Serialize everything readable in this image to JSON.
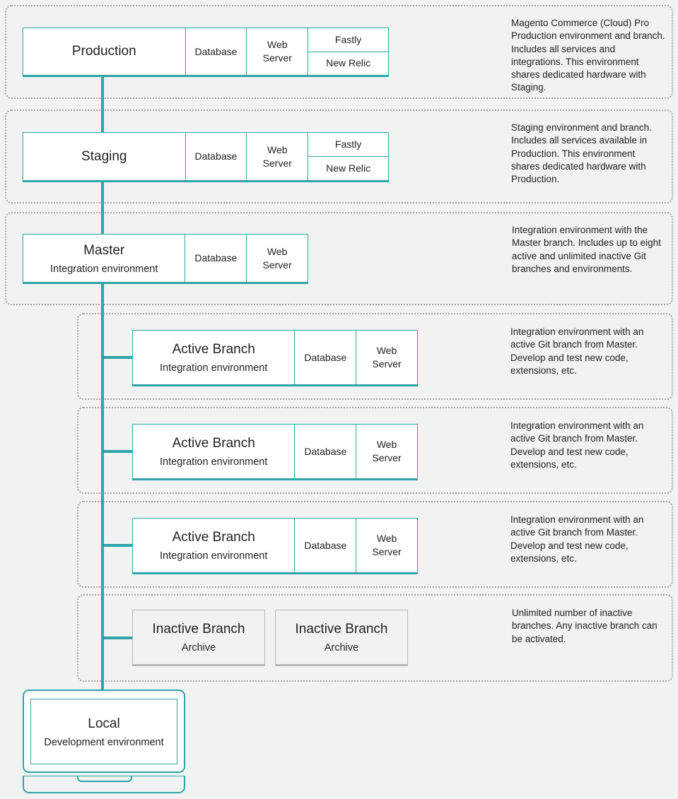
{
  "colors": {
    "accent": "#2fa3a8",
    "background": "#f1f3f2",
    "inactive": "#b5b8b8"
  },
  "production": {
    "title": "Production",
    "services": [
      "Database",
      "Web\nServer"
    ],
    "addons": [
      "Fastly",
      "New Relic"
    ],
    "description": "Magento Commerce (Cloud) Pro Production environment and branch. Includes all services and integrations. This environment shares dedicated hardware with Staging."
  },
  "staging": {
    "title": "Staging",
    "services": [
      "Database",
      "Web\nServer"
    ],
    "addons": [
      "Fastly",
      "New Relic"
    ],
    "description": "Staging environment and branch. Includes all services available in Production. This environment shares dedicated hardware with Production."
  },
  "master": {
    "title": "Master",
    "subtitle": "Integration environment",
    "services": [
      "Database",
      "Web\nServer"
    ],
    "description": "Integration environment with the Master branch. Includes up to eight active and unlimited inactive Git branches and environments."
  },
  "active_branches": [
    {
      "title": "Active Branch",
      "subtitle": "Integration environment",
      "services": [
        "Database",
        "Web\nServer"
      ],
      "description": "Integration environment with an active Git branch from Master. Develop and test new code, extensions, etc."
    },
    {
      "title": "Active Branch",
      "subtitle": "Integration environment",
      "services": [
        "Database",
        "Web\nServer"
      ],
      "description": "Integration environment with an active Git branch from Master. Develop and test new code, extensions, etc."
    },
    {
      "title": "Active Branch",
      "subtitle": "Integration environment",
      "services": [
        "Database",
        "Web\nServer"
      ],
      "description": "Integration environment with an active Git branch from Master. Develop and test new code, extensions, etc."
    }
  ],
  "inactive": {
    "branches": [
      {
        "title": "Inactive Branch",
        "subtitle": "Archive"
      },
      {
        "title": "Inactive Branch",
        "subtitle": "Archive"
      }
    ],
    "description": "Unlimited number of inactive branches. Any inactive branch can be activated."
  },
  "local": {
    "title": "Local",
    "subtitle": "Development environment"
  }
}
